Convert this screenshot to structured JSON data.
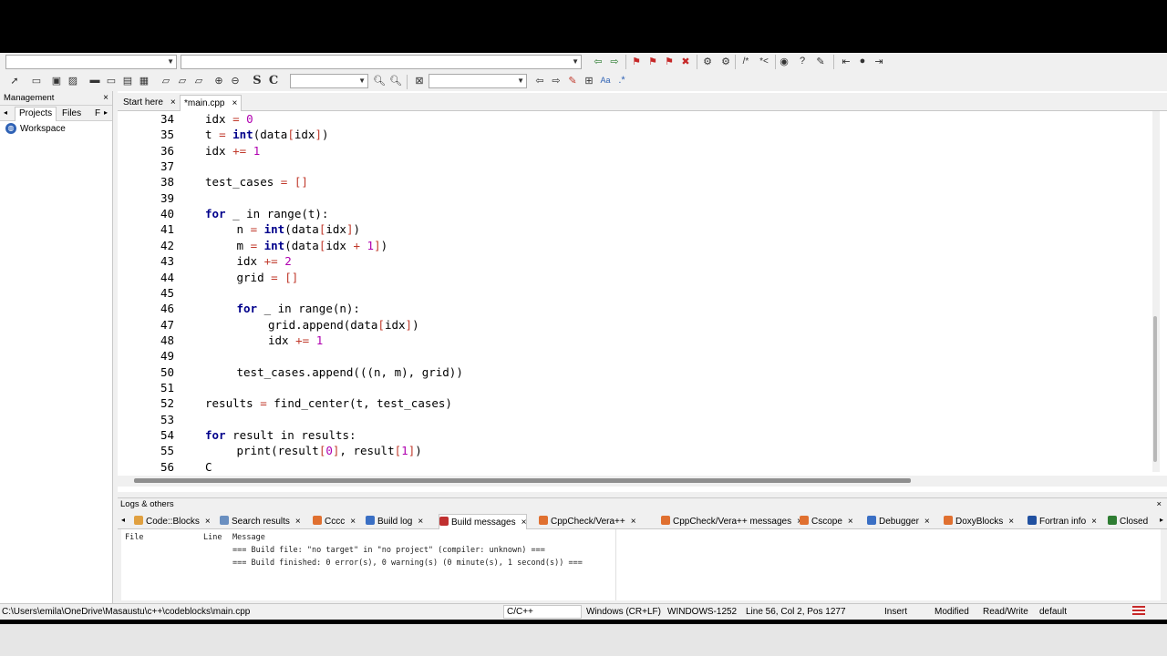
{
  "editor": {
    "tabs": [
      {
        "label": "Start here",
        "close": "×"
      },
      {
        "label": "*main.cpp",
        "close": "×"
      }
    ],
    "lines": [
      {
        "num": "34",
        "indent": 0,
        "tokens": [
          [
            "t",
            "idx "
          ],
          [
            "op",
            "="
          ],
          [
            "t",
            " "
          ],
          [
            "num",
            "0"
          ]
        ]
      },
      {
        "num": "35",
        "indent": 0,
        "tokens": [
          [
            "t",
            "t "
          ],
          [
            "op",
            "="
          ],
          [
            "t",
            " "
          ],
          [
            "kw",
            "int"
          ],
          [
            "t",
            "(data"
          ],
          [
            "op",
            "["
          ],
          [
            "t",
            "idx"
          ],
          [
            "op",
            "]"
          ],
          [
            "t",
            ")"
          ]
        ]
      },
      {
        "num": "36",
        "indent": 0,
        "tokens": [
          [
            "t",
            "idx "
          ],
          [
            "op",
            "+="
          ],
          [
            "t",
            " "
          ],
          [
            "num",
            "1"
          ]
        ]
      },
      {
        "num": "37",
        "indent": 0,
        "tokens": []
      },
      {
        "num": "38",
        "indent": 0,
        "tokens": [
          [
            "t",
            "test_cases "
          ],
          [
            "op",
            "="
          ],
          [
            "t",
            " "
          ],
          [
            "op",
            "[]"
          ]
        ]
      },
      {
        "num": "39",
        "indent": 0,
        "tokens": []
      },
      {
        "num": "40",
        "indent": 0,
        "tokens": [
          [
            "kw",
            "for"
          ],
          [
            "t",
            " _ in range(t):"
          ]
        ]
      },
      {
        "num": "41",
        "indent": 1,
        "tokens": [
          [
            "t",
            "n "
          ],
          [
            "op",
            "="
          ],
          [
            "t",
            " "
          ],
          [
            "kw",
            "int"
          ],
          [
            "t",
            "(data"
          ],
          [
            "op",
            "["
          ],
          [
            "t",
            "idx"
          ],
          [
            "op",
            "]"
          ],
          [
            "t",
            ")"
          ]
        ]
      },
      {
        "num": "42",
        "indent": 1,
        "tokens": [
          [
            "t",
            "m "
          ],
          [
            "op",
            "="
          ],
          [
            "t",
            " "
          ],
          [
            "kw",
            "int"
          ],
          [
            "t",
            "(data"
          ],
          [
            "op",
            "["
          ],
          [
            "t",
            "idx "
          ],
          [
            "op",
            "+"
          ],
          [
            "t",
            " "
          ],
          [
            "num",
            "1"
          ],
          [
            "op",
            "]"
          ],
          [
            "t",
            ")"
          ]
        ]
      },
      {
        "num": "43",
        "indent": 1,
        "tokens": [
          [
            "t",
            "idx "
          ],
          [
            "op",
            "+="
          ],
          [
            "t",
            " "
          ],
          [
            "num",
            "2"
          ]
        ]
      },
      {
        "num": "44",
        "indent": 1,
        "tokens": [
          [
            "t",
            "grid "
          ],
          [
            "op",
            "="
          ],
          [
            "t",
            " "
          ],
          [
            "op",
            "[]"
          ]
        ]
      },
      {
        "num": "45",
        "indent": 0,
        "tokens": []
      },
      {
        "num": "46",
        "indent": 1,
        "tokens": [
          [
            "kw",
            "for"
          ],
          [
            "t",
            " _ in range(n):"
          ]
        ]
      },
      {
        "num": "47",
        "indent": 2,
        "tokens": [
          [
            "t",
            "grid.append(data"
          ],
          [
            "op",
            "["
          ],
          [
            "t",
            "idx"
          ],
          [
            "op",
            "]"
          ],
          [
            "t",
            ")"
          ]
        ]
      },
      {
        "num": "48",
        "indent": 2,
        "tokens": [
          [
            "t",
            "idx "
          ],
          [
            "op",
            "+="
          ],
          [
            "t",
            " "
          ],
          [
            "num",
            "1"
          ]
        ]
      },
      {
        "num": "49",
        "indent": 0,
        "tokens": []
      },
      {
        "num": "50",
        "indent": 1,
        "tokens": [
          [
            "t",
            "test_cases.append(((n, m), grid))"
          ]
        ]
      },
      {
        "num": "51",
        "indent": 0,
        "tokens": []
      },
      {
        "num": "52",
        "indent": 0,
        "tokens": [
          [
            "t",
            "results "
          ],
          [
            "op",
            "="
          ],
          [
            "t",
            " find_center(t, test_cases)"
          ]
        ]
      },
      {
        "num": "53",
        "indent": 0,
        "tokens": []
      },
      {
        "num": "54",
        "indent": 0,
        "tokens": [
          [
            "kw",
            "for"
          ],
          [
            "t",
            " result in results:"
          ]
        ]
      },
      {
        "num": "55",
        "indent": 1,
        "tokens": [
          [
            "t",
            "print(result"
          ],
          [
            "op",
            "["
          ],
          [
            "num",
            "0"
          ],
          [
            "op",
            "]"
          ],
          [
            "t",
            ", result"
          ],
          [
            "op",
            "["
          ],
          [
            "num",
            "1"
          ],
          [
            "op",
            "]"
          ],
          [
            "t",
            ")"
          ]
        ]
      },
      {
        "num": "56",
        "indent": 0,
        "tokens": [
          [
            "t",
            "C"
          ]
        ]
      }
    ]
  },
  "management": {
    "title": "Management",
    "close": "×",
    "tabs": [
      "Projects",
      "Files",
      "F"
    ],
    "workspace": "Workspace"
  },
  "logs": {
    "title": "Logs & others",
    "close": "×",
    "tabs": [
      {
        "label": "Code::Blocks",
        "color": "#e0a040"
      },
      {
        "label": "Search results",
        "color": "#6a8fc0"
      },
      {
        "label": "Cccc",
        "color": "#e07030"
      },
      {
        "label": "Build log",
        "color": "#3a6fc4"
      },
      {
        "label": "Build messages",
        "color": "#c03030"
      },
      {
        "label": "CppCheck/Vera++",
        "color": "#e07030"
      },
      {
        "label": "CppCheck/Vera++ messages",
        "color": "#e07030"
      },
      {
        "label": "Cscope",
        "color": "#e07030"
      },
      {
        "label": "Debugger",
        "color": "#3a6fc4"
      },
      {
        "label": "DoxyBlocks",
        "color": "#e07030"
      },
      {
        "label": "Fortran info",
        "color": "#2050a0"
      },
      {
        "label": "Closed",
        "color": "#2e7d32"
      }
    ],
    "headers": {
      "file": "File",
      "line": "Line",
      "message": "Message"
    },
    "messages": [
      "=== Build file: \"no target\" in \"no project\" (compiler: unknown) ===",
      "=== Build finished: 0 error(s), 0 warning(s) (0 minute(s), 1 second(s)) ==="
    ]
  },
  "status": {
    "path": "C:\\Users\\emila\\OneDrive\\Masaustu\\c++\\codeblocks\\main.cpp",
    "language": "C/C++",
    "eol": "Windows (CR+LF)",
    "encoding": "WINDOWS-1252",
    "position": "Line 56, Col 2, Pos 1277",
    "mode": "Insert",
    "modified": "Modified",
    "access": "Read/Write",
    "profile": "default"
  },
  "toolbar": {
    "bold_s": "S",
    "bold_c": "C"
  }
}
